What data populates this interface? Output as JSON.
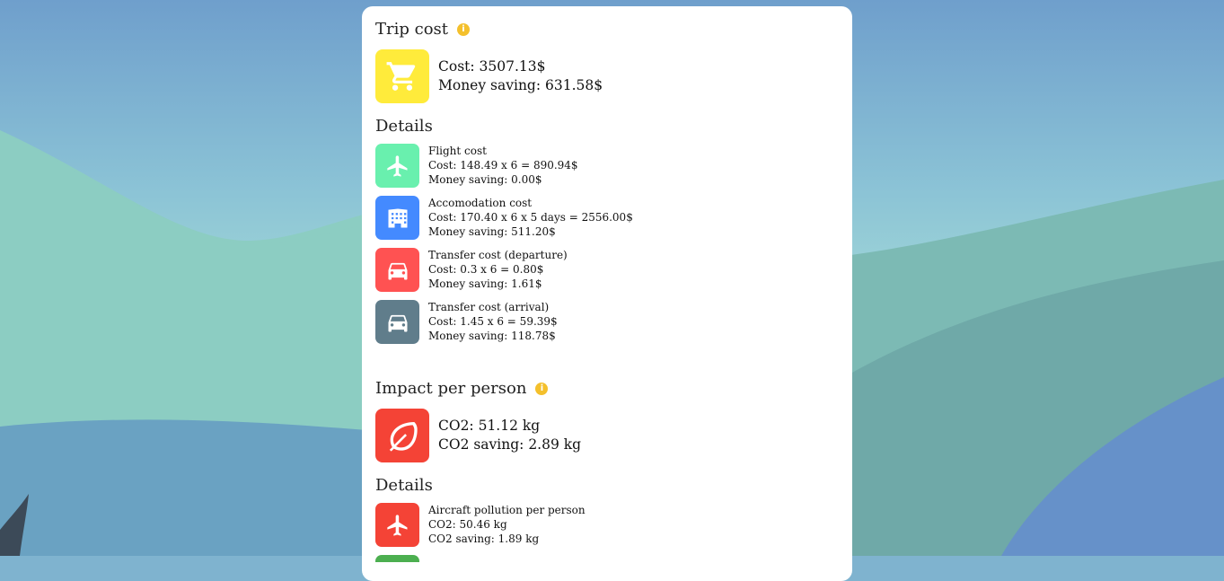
{
  "trip_cost": {
    "title": "Trip cost",
    "info_icon": "info-icon",
    "cost": "Cost: 3507.13$",
    "saving": "Money saving: 631.58$",
    "icon": "shopping-cart-icon",
    "icon_color": "#ffeb3b",
    "details_title": "Details",
    "items": [
      {
        "icon": "airplane-icon",
        "color": "#69f0ae",
        "title": "Flight cost",
        "line1": "Cost: 148.49 x 6 = 890.94$",
        "line2": "Money saving: 0.00$"
      },
      {
        "icon": "building-icon",
        "color": "#448aff",
        "title": "Accomodation cost",
        "line1": "Cost: 170.40 x 6 x 5 days = 2556.00$",
        "line2": "Money saving: 511.20$"
      },
      {
        "icon": "car-icon",
        "color": "#ff5252",
        "title": "Transfer cost (departure)",
        "line1": "Cost: 0.3 x 6 = 0.80$",
        "line2": "Money saving: 1.61$"
      },
      {
        "icon": "car-icon",
        "color": "#607d8b",
        "title": "Transfer cost (arrival)",
        "line1": "Cost: 1.45 x 6 = 59.39$",
        "line2": "Money saving: 118.78$"
      }
    ]
  },
  "impact": {
    "title": "Impact per person",
    "info_icon": "info-icon",
    "co2": "CO2: 51.12 kg",
    "saving": "CO2 saving: 2.89 kg",
    "icon": "leaf-icon",
    "icon_color": "#f44336",
    "details_title": "Details",
    "items": [
      {
        "icon": "airplane-icon",
        "color": "#f44336",
        "title": "Aircraft pollution per person",
        "line1": "CO2: 50.46 kg",
        "line2": "CO2 saving: 1.89 kg"
      }
    ]
  }
}
